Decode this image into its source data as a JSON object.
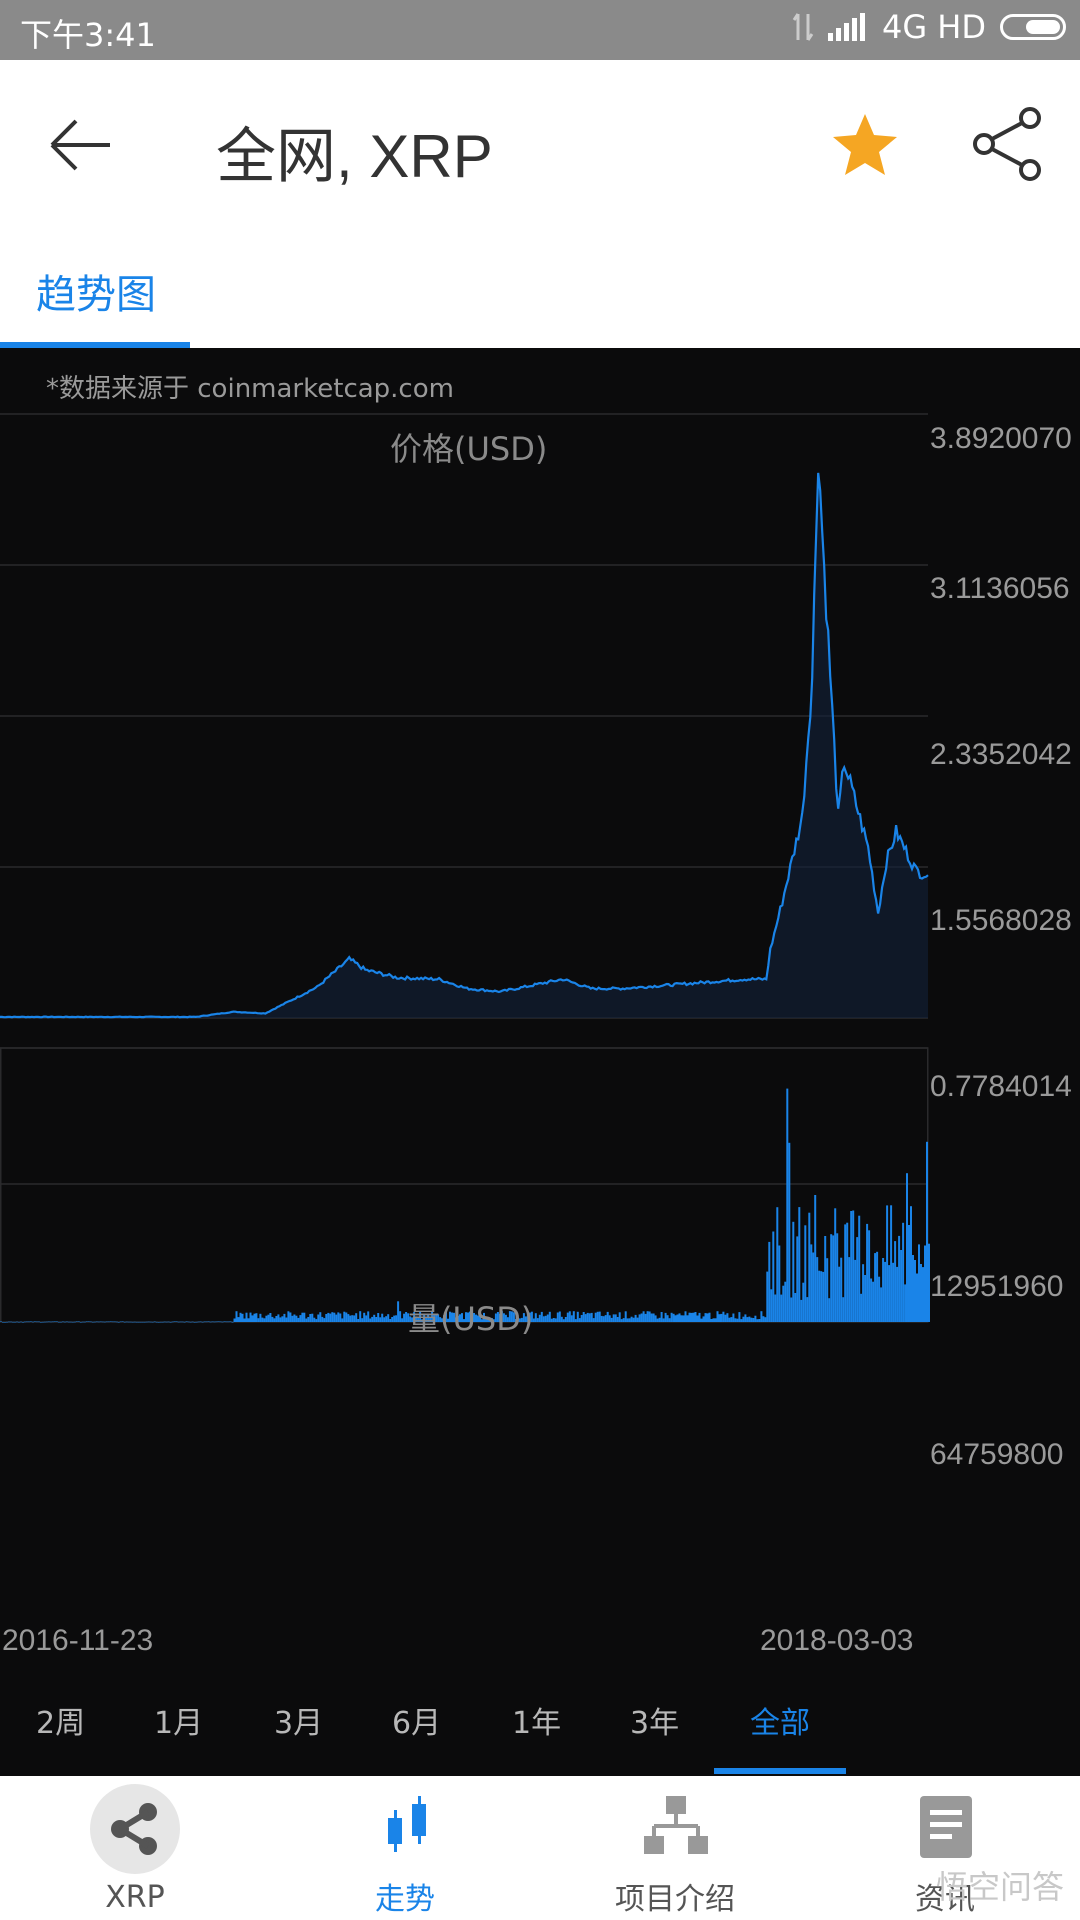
{
  "status_bar": {
    "time": "下午3:41",
    "network": "4G HD"
  },
  "header": {
    "title": "全网, XRP"
  },
  "tabs": [
    {
      "label": "趋势图"
    }
  ],
  "source_note": "*数据来源于 coinmarketcap.com",
  "price_panel": {
    "title": "价格(USD)",
    "y_ticks": [
      "3.8920070",
      "3.1136056",
      "2.3352042",
      "1.5568028",
      "0.7784014"
    ]
  },
  "volume_panel": {
    "title": "量(USD)",
    "y_ticks": [
      "12951960",
      "64759800"
    ]
  },
  "x_axis": {
    "start": "2016-11-23",
    "end": "2018-03-03"
  },
  "range_buttons": [
    "2周",
    "1月",
    "3月",
    "6月",
    "1年",
    "3年",
    "全部"
  ],
  "active_range": "全部",
  "bottom_nav": {
    "items": [
      "XRP",
      "走势",
      "项目介绍",
      "资讯"
    ],
    "active": "走势"
  },
  "watermark": "悟空问答",
  "colors": {
    "accent": "#1a84e8",
    "chart_bg": "#0b0b0c",
    "star": "#f5a623"
  },
  "chart_data": [
    {
      "type": "area",
      "title": "价格(USD)",
      "x_range": [
        "2016-11-23",
        "2018-03-03"
      ],
      "ylim": [
        0,
        3.892007
      ],
      "x": [
        "2016-11-23",
        "2017-01-15",
        "2017-03-01",
        "2017-03-20",
        "2017-04-05",
        "2017-05-01",
        "2017-05-17",
        "2017-05-25",
        "2017-06-10",
        "2017-07-01",
        "2017-07-15",
        "2017-08-01",
        "2017-09-01",
        "2017-09-15",
        "2017-10-01",
        "2017-11-01",
        "2017-12-01",
        "2017-12-12",
        "2017-12-14",
        "2017-12-20",
        "2017-12-30",
        "2018-01-04",
        "2018-01-07",
        "2018-01-10",
        "2018-01-17",
        "2018-01-20",
        "2018-02-01",
        "2018-02-06",
        "2018-02-10",
        "2018-02-15",
        "2018-02-25",
        "2018-03-03"
      ],
      "values": [
        0.007,
        0.007,
        0.007,
        0.04,
        0.03,
        0.2,
        0.38,
        0.31,
        0.26,
        0.25,
        0.19,
        0.17,
        0.25,
        0.19,
        0.19,
        0.22,
        0.25,
        0.25,
        0.44,
        0.75,
        1.3,
        2.2,
        3.65,
        2.9,
        1.3,
        1.65,
        1.1,
        0.68,
        1.0,
        1.2,
        0.95,
        0.92
      ]
    },
    {
      "type": "bar",
      "title": "量(USD)",
      "x_range": [
        "2016-11-23",
        "2018-03-03"
      ],
      "ylim": [
        0,
        12951960
      ],
      "note": "daily volume, sparse low values until Dec 2017 then spikes"
    }
  ]
}
